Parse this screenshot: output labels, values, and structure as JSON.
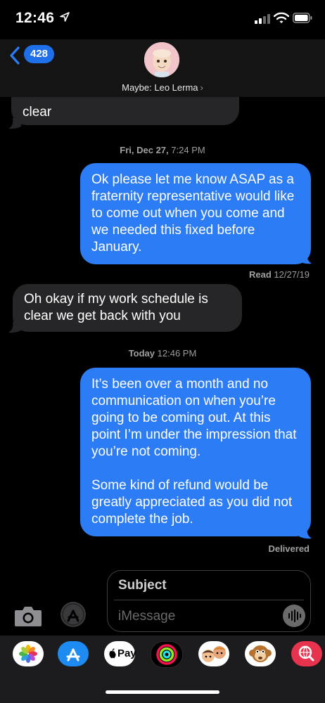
{
  "status_bar": {
    "time": "12:46",
    "location_icon": "location-arrow-icon",
    "signal_icon": "signal-bars-icon",
    "wifi_icon": "wifi-icon",
    "battery_icon": "battery-icon"
  },
  "header": {
    "back_count": "428",
    "contact_name": "Maybe: Leo Lerma",
    "chevron": "›"
  },
  "messages": {
    "m1_text": "clear",
    "timestamp1_day": "Fri, Dec 27,",
    "timestamp1_time": "7:24 PM",
    "m2_text": "Ok please let me know ASAP as a fraternity representative would like to come out when you come and we needed this fixed before January.",
    "read_label": "Read",
    "read_date": "12/27/19",
    "m3_text": "Oh okay if my work schedule is clear we get back with you",
    "timestamp2_day": "Today",
    "timestamp2_time": "12:46 PM",
    "m4_para1": "It’s been over a month and no communication on when you’re going to be coming out. At this point I’m under the impression that you’re not coming.",
    "m4_para2": "Some kind of refund would be greatly appreciated as you did not complete the job.",
    "delivered_label": "Delivered"
  },
  "composer": {
    "subject_placeholder": "Subject",
    "message_placeholder": "iMessage"
  },
  "app_drawer": {
    "apps": [
      "photos-app-icon",
      "app-store-app-icon",
      "apple-pay-app-icon",
      "activity-app-icon",
      "memoji-app-icon",
      "animoji-app-icon",
      "web-search-app-icon"
    ],
    "applepay_label": "Pay"
  },
  "colors": {
    "outgoing_bubble": "#2c7cf6",
    "incoming_bubble": "#262628",
    "background": "#000000",
    "badge": "#1e6fe8"
  }
}
